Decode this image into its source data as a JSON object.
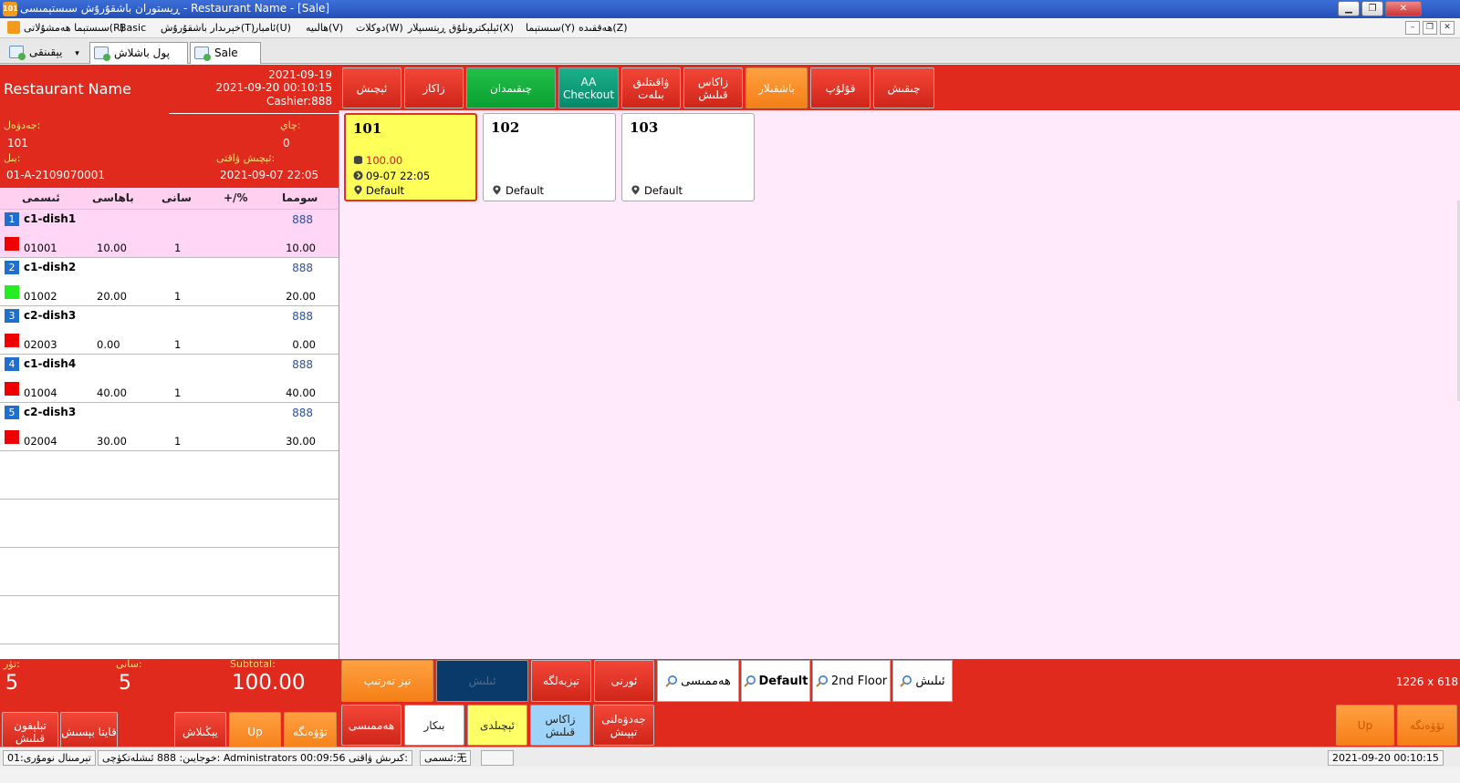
{
  "window": {
    "title": "ڕیستوران باشقۇرۇش سىستېمىسى - Restaurant Name - [Sale]",
    "logo_text": "101",
    "btn_min": "▁",
    "btn_max": "❐",
    "btn_close": "✕"
  },
  "menu": {
    "items": [
      "سىستېما ھەمشۇلاتى(R)",
      "Basic",
      "خېرىدار باشقۇرۇش(T)",
      "ئامبار(U)",
      "ھالىيە(V)",
      "دوكلات(W)",
      "ئېلېكترونلۇق ڕېتسىپلار(X)",
      "سىستېما(Y)",
      "ھەققىدە(Z)"
    ],
    "mdi_min": "–",
    "mdi_restore": "❐",
    "mdi_close": "✕"
  },
  "tabs": [
    {
      "label": "يېقىنقى",
      "arrow": "▾"
    },
    {
      "label": "پول باشلاش"
    },
    {
      "label": "Sale"
    }
  ],
  "order": {
    "restaurant_name": "Restaurant Name",
    "date": "2021-09-19",
    "datetime": "2021-09-20 00:10:15",
    "cashier": "Cashier:888",
    "table_label": "جەدۋەل:",
    "table_value": "101",
    "seat_label": "چاي:",
    "seat_value": "0",
    "bill_label": "بىل:",
    "bill_value": "01-A-2109070001",
    "open_time_label": "ئېچىش ۋاقتى:",
    "open_time_value": "2021-09-07 22:05"
  },
  "columns": [
    "ئىسمى",
    "باھاسى",
    "سانى",
    "+/%",
    "سومما"
  ],
  "items": [
    {
      "no": "1",
      "name": "c1-dish1",
      "kitchen": "888",
      "code": "01001",
      "price": "10.00",
      "qty": "1",
      "amount": "10.00",
      "color": "#f00000"
    },
    {
      "no": "2",
      "name": "c1-dish2",
      "kitchen": "888",
      "code": "01002",
      "price": "20.00",
      "qty": "1",
      "amount": "20.00",
      "color": "#22ee22"
    },
    {
      "no": "3",
      "name": "c2-dish3",
      "kitchen": "888",
      "code": "02003",
      "price": "0.00",
      "qty": "1",
      "amount": "0.00",
      "color": "#f00000"
    },
    {
      "no": "4",
      "name": "c1-dish4",
      "kitchen": "888",
      "code": "01004",
      "price": "40.00",
      "qty": "1",
      "amount": "40.00",
      "color": "#f00000"
    },
    {
      "no": "5",
      "name": "c2-dish3",
      "kitchen": "888",
      "code": "02004",
      "price": "30.00",
      "qty": "1",
      "amount": "30.00",
      "color": "#f00000"
    }
  ],
  "totals": {
    "kind_label": "تۈر:",
    "kind_value": "5",
    "count_label": "سانى:",
    "count_value": "5",
    "subtotal_label": "Subtotal:",
    "subtotal_value": "100.00"
  },
  "left_buttons": [
    "تېلېفون قىلىش",
    "قايتا بېسىش",
    "يېڭىلاش",
    "Up",
    "تۆۋەنگە"
  ],
  "top_buttons": [
    "ئېچىش",
    "زاكاز",
    "چىقىمدان",
    "AA Checkout",
    "ۋاقىتلىق بىلەت",
    "زاكاس قىلىش",
    "باشقىلار",
    "قۇلۇپ",
    "چىقىش"
  ],
  "tables": [
    {
      "name": "101",
      "amount": "100.00",
      "time": "09-07 22:05",
      "area": "Default",
      "occupied": true
    },
    {
      "name": "102",
      "area": "Default",
      "occupied": false
    },
    {
      "name": "103",
      "area": "Default",
      "occupied": false
    }
  ],
  "filter_row1": [
    "تېز تەرتىپ",
    "ئىلىش",
    "تېزبەلگە",
    "ئورنى"
  ],
  "area_buttons": [
    "ھەممىسى",
    "Default",
    "2nd Floor",
    "ئىلىش"
  ],
  "filter_row2": [
    "ھەممىسى",
    "بىكار",
    "ئېچىلدى",
    "زاكاس قىلىش",
    "جەدۋەلنى تېپىش"
  ],
  "size_label": "1226 x 618",
  "right_buttons": [
    "Up",
    "تۆۋەنگە"
  ],
  "status": {
    "terminal": "تېرمىنال نومۇرى:01",
    "user": "خوجايىن: 888 ئىشلەتكۈچى: Administrators 00:09:56 كىرىش ۋاقتى:",
    "name": "ئىسمى:无",
    "empty": "",
    "time": "2021-09-20 00:10:15"
  }
}
